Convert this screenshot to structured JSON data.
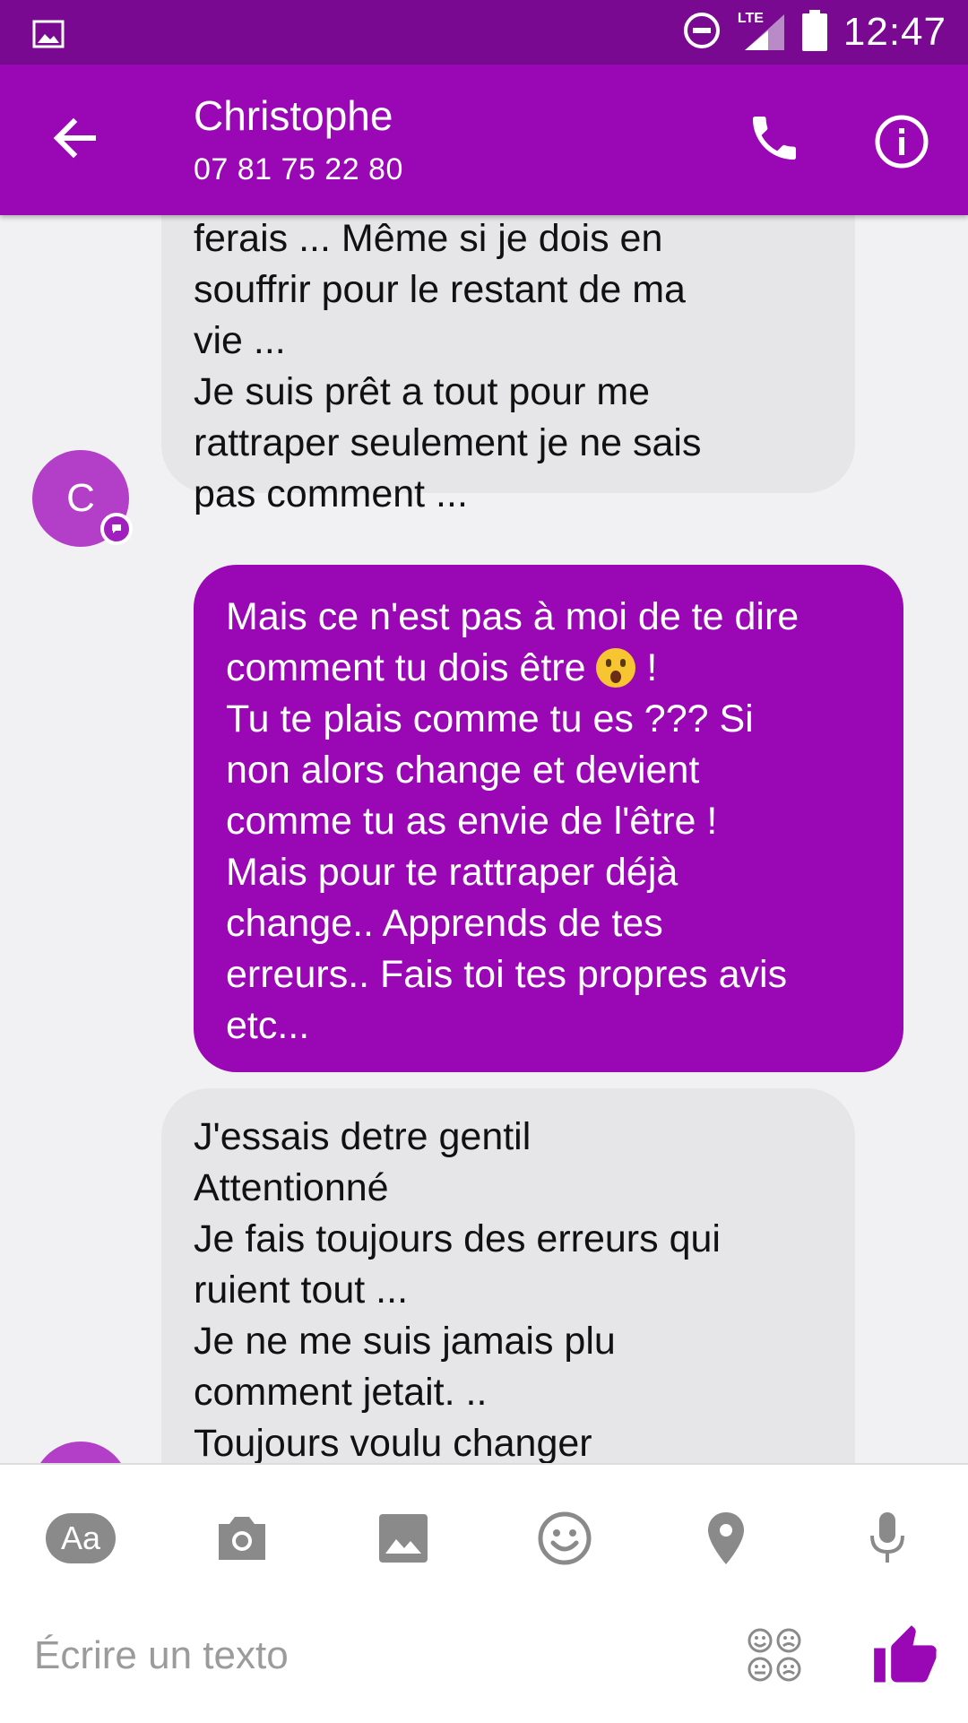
{
  "status_bar": {
    "network": "LTE",
    "time": "12:47"
  },
  "header": {
    "contact_name": "Christophe",
    "phone_number": "07 81 75 22 80"
  },
  "messages": [
    {
      "direction": "incoming",
      "text": "ferais ... Même si je dois en\nsouffrir pour le restant de ma\nvie ...\nJe suis prêt a tout pour me\nrattraper seulement je ne sais\npas comment ..."
    },
    {
      "direction": "outgoing",
      "text_before_emoji": "Mais ce n'est pas à moi de te dire\ncomment tu dois être ",
      "emoji": "astonished-face",
      "text_after_emoji": " !\nTu te plais comme tu es ??? Si\nnon alors change et devient\ncomme tu as envie de l'être !\nMais pour te rattraper déjà\nchange.. Apprends de tes\nerreurs.. Fais toi tes propres avis\netc..."
    },
    {
      "direction": "incoming",
      "text": "J'essais detre gentil\nAttentionné\nJe fais toujours des erreurs qui\nruient tout ...\nJe ne me suis jamais plu\ncomment jetait. ..\nToujours voulu changer"
    }
  ],
  "avatar": {
    "initial": "C",
    "color": "#b33fc9"
  },
  "composer": {
    "aa_label": "Aa",
    "placeholder": "Écrire un texto",
    "tools": [
      "text-format-icon",
      "camera-icon",
      "image-icon",
      "emoji-icon",
      "location-pin-icon",
      "microphone-icon"
    ]
  },
  "colors": {
    "status_bar": "#780990",
    "accent": "#9a08b6",
    "incoming_bubble": "#e6e6e8",
    "background": "#f1f1f3"
  }
}
